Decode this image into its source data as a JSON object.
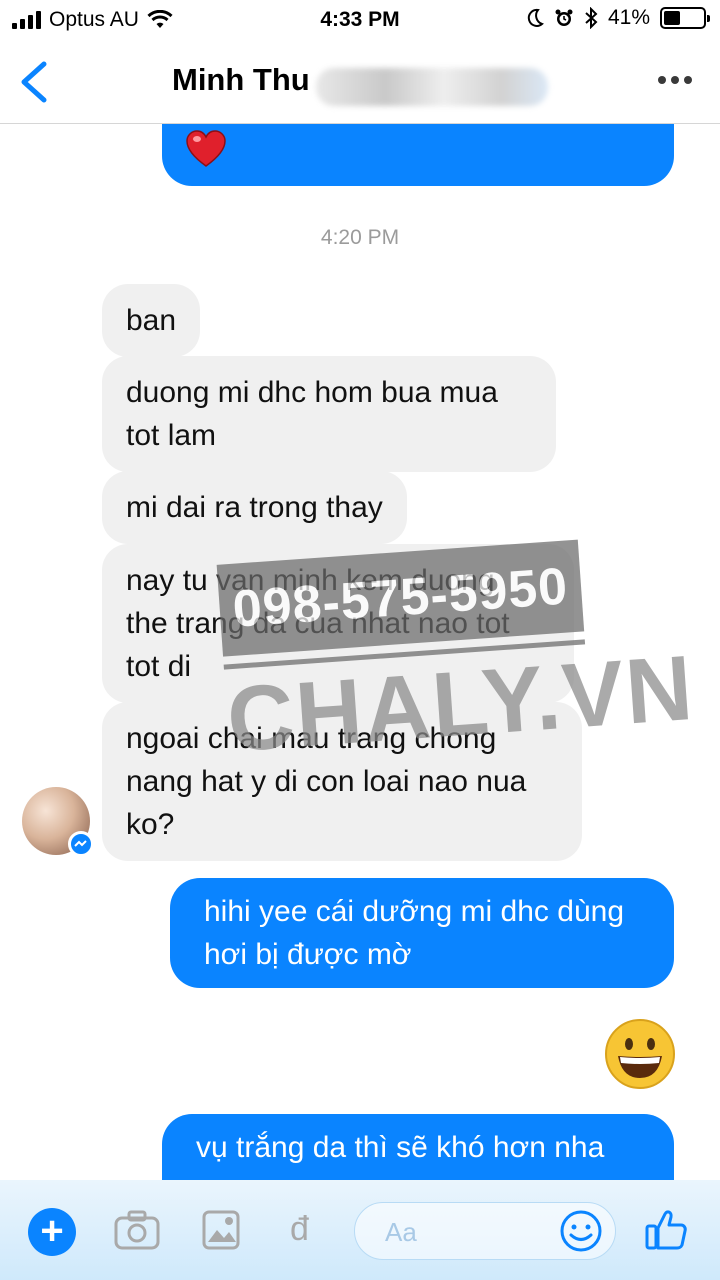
{
  "status_bar": {
    "carrier": "Optus AU",
    "time": "4:33 PM",
    "battery": "41%",
    "battery_level": 0.41
  },
  "header": {
    "contact_name": "Minh Thu"
  },
  "chat": {
    "timestamp": "4:20 PM",
    "incoming": [
      "ban",
      "duong mi dhc hom bua mua\ntot lam",
      "mi dai ra trong thay",
      "nay tu van minh kem duong\nthe trang da cua nhat nao tot\ntot di",
      "ngoai chai mau trang chong\nnang hat y di con loai nao nua\nko?"
    ],
    "outgoing": [
      "hihi yee cái dưỡng mi dhc dùng\nhơi bị được mờ",
      "vụ trắng da thì sẽ khó hơn nha"
    ]
  },
  "watermark": {
    "phone": "098-575-5950",
    "site": "CHALY.VN"
  },
  "composer": {
    "placeholder": "Aa"
  },
  "colors": {
    "accent": "#0a84ff",
    "incoming_bubble": "#f0f0f0",
    "composer_bg": "#d7ecfb"
  },
  "icons": [
    "signal-icon",
    "wifi-icon",
    "moon-icon",
    "alarm-icon",
    "bluetooth-icon",
    "battery-icon",
    "back-icon",
    "more-icon",
    "heart-emoji",
    "grin-emoji",
    "plus-icon",
    "camera-icon",
    "photo-icon",
    "dong-icon",
    "smile-icon",
    "like-icon"
  ]
}
